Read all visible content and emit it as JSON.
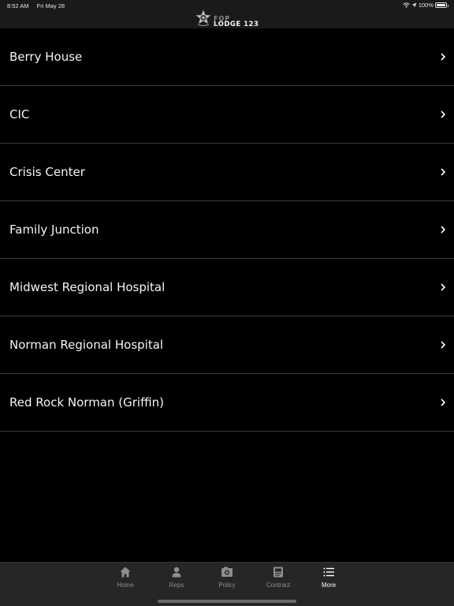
{
  "status_bar": {
    "time": "8:52 AM",
    "date": "Fri May 28",
    "battery": "100%",
    "icons": [
      "wifi-icon",
      "location-icon",
      "battery-icon"
    ]
  },
  "header": {
    "logo_line1": "FOP",
    "logo_line2": "LODGE 123"
  },
  "list": {
    "items": [
      {
        "label": "Berry House"
      },
      {
        "label": "CIC"
      },
      {
        "label": "Crisis Center"
      },
      {
        "label": "Family Junction"
      },
      {
        "label": "Midwest Regional Hospital"
      },
      {
        "label": "Norman Regional Hospital"
      },
      {
        "label": "Red Rock Norman (Griffin)"
      }
    ]
  },
  "tab_bar": {
    "tabs": [
      {
        "label": "Home",
        "icon": "home-icon"
      },
      {
        "label": "Reps",
        "icon": "person-icon"
      },
      {
        "label": "Policy",
        "icon": "policy-icon"
      },
      {
        "label": "Contract",
        "icon": "contract-icon"
      },
      {
        "label": "More",
        "icon": "list-icon",
        "active": true
      }
    ]
  },
  "colors": {
    "background": "#000000",
    "nav_bar": "#1a1a1a",
    "tab_bar": "#262626",
    "inactive_tab": "#8e8e8e",
    "active_tab": "#ffffff"
  }
}
